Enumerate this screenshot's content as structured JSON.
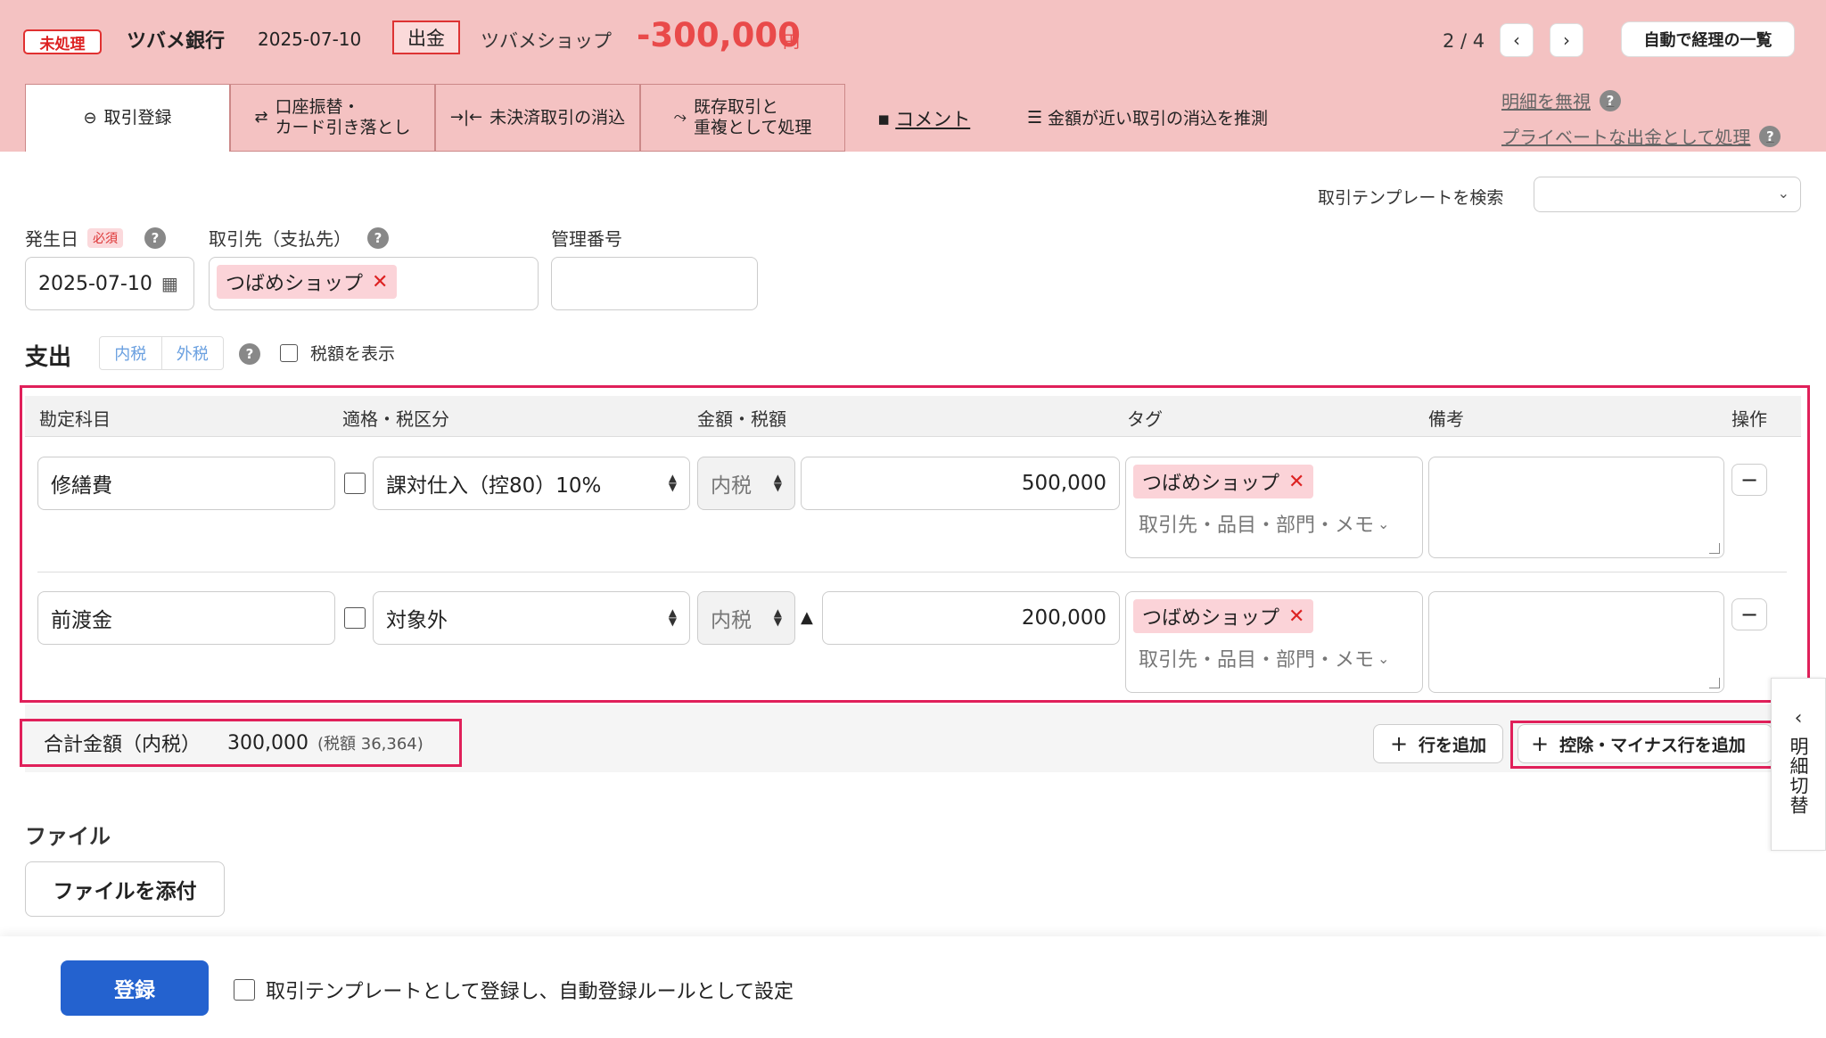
{
  "header": {
    "status_badge": "未処理",
    "bank_name": "ツバメ銀行",
    "date": "2025-07-10",
    "type_badge": "出金",
    "shop_name": "ツバメショップ",
    "amount": "-300,000",
    "currency": "円",
    "pager": "2 / 4",
    "prev_icon": "chevron-left-icon",
    "next_icon": "chevron-right-icon",
    "auto_list_button": "自動で経理の一覧"
  },
  "tabs": [
    {
      "label": "取引登録",
      "icon": "minus-circle-icon",
      "active": true
    },
    {
      "label1": "口座振替・",
      "label2": "カード引き落とし",
      "icon": "transfer-icon"
    },
    {
      "label": "未決済取引の消込",
      "icon": "merge-icon"
    },
    {
      "label1": "既存取引と",
      "label2": "重複として処理",
      "icon": "duplicate-icon"
    }
  ],
  "links": {
    "comment": "コメント",
    "infer": "金額が近い取引の消込を推測",
    "ignore": "明細を無視",
    "private": "プライベートな出金として処理",
    "help": "?"
  },
  "form": {
    "template_search_label": "取引テンプレートを検索",
    "template_search_value": "",
    "date_label": "発生日",
    "required": "必須",
    "date_value": "2025-07-10",
    "partner_label": "取引先（支払先）",
    "partner_value": "つばめショップ",
    "mgmt_label": "管理番号",
    "mgmt_value": ""
  },
  "expense": {
    "title": "支出",
    "tax_included": "内税",
    "tax_excluded": "外税",
    "show_tax_label": "税額を表示",
    "columns": [
      "勘定科目",
      "適格・税区分",
      "金額・税額",
      "タグ",
      "備考",
      "操作"
    ],
    "rows": [
      {
        "account": "修繕費",
        "tax_category": "課対仕入（控80）10%",
        "tax_mode": "内税",
        "minus_mark": "",
        "amount": "500,000",
        "tag": "つばめショップ",
        "tag_placeholder": "取引先・品目・部門・メモ",
        "memo": ""
      },
      {
        "account": "前渡金",
        "tax_category": "対象外",
        "tax_mode": "内税",
        "minus_mark": "▲",
        "amount": "200,000",
        "tag": "つばめショップ",
        "tag_placeholder": "取引先・品目・部門・メモ",
        "memo": ""
      }
    ]
  },
  "totals": {
    "label": "合計金額（内税）",
    "amount": "300,000",
    "tax": "(税額 36,364)",
    "add_row": "行を追加",
    "add_deduction_row": "控除・マイナス行を追加"
  },
  "side_tab": {
    "label": "明細切替"
  },
  "file": {
    "title": "ファイル",
    "attach_button": "ファイルを添付"
  },
  "footer": {
    "register_button": "登録",
    "template_option": "取引テンプレートとして登録し、自動登録ルールとして設定"
  }
}
